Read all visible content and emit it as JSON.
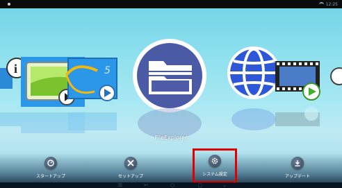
{
  "status_bar": {
    "time": "12:25",
    "icons": [
      "notification-dot",
      "wifi-icon"
    ]
  },
  "carousel": {
    "items": [
      {
        "name": "info",
        "icon": "info-icon"
      },
      {
        "name": "media-player",
        "icon": "tablet-play-icon"
      },
      {
        "name": "video-player",
        "icon": "blue-screen-play-icon"
      },
      {
        "name": "file-explorer",
        "icon": "folder-icon"
      },
      {
        "name": "browser",
        "icon": "globe-icon"
      },
      {
        "name": "video",
        "icon": "film-play-icon"
      }
    ],
    "caption": "FileExplorer",
    "colors": {
      "sky": "#8fe0ee",
      "folder": "#4f5da8",
      "globe": "#2d57d6",
      "accent": "#2b97e8"
    }
  },
  "bottom_nav": {
    "items": [
      {
        "label": "スタートアップ",
        "icon": "power-clock-icon"
      },
      {
        "label": "セットアップ",
        "icon": "tools-icon"
      },
      {
        "label": "システム設定",
        "icon": "gear-icon",
        "highlight": true,
        "highlight_color": "#e00000"
      },
      {
        "label": "アップデート",
        "icon": "download-icon"
      }
    ]
  },
  "android_nav": {
    "buttons": [
      "menu-icon",
      "back-icon",
      "home-icon",
      "recent-apps-icon",
      "chevron-down-icon"
    ]
  }
}
